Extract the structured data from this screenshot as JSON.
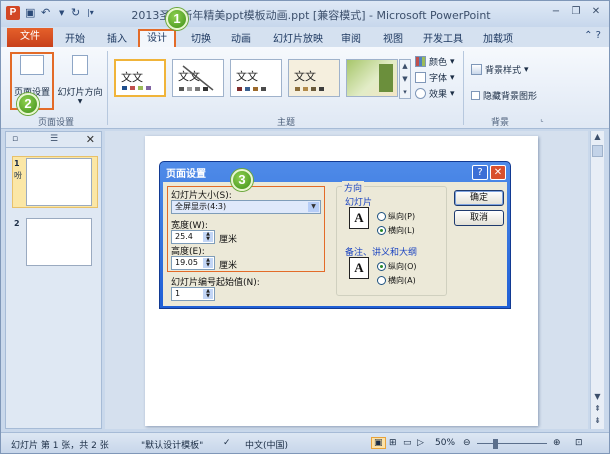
{
  "title_bar": {
    "title": "2013圣诞新年精美ppt模板动画.ppt [兼容模式] - Microsoft PowerPoint",
    "app_icon": "P",
    "quick_access": [
      "save-icon",
      "undo-icon",
      "redo-icon"
    ],
    "window_buttons": [
      "minimize-icon",
      "restore-icon",
      "close-icon"
    ]
  },
  "tabs": {
    "file": "文件",
    "items": [
      "开始",
      "插入",
      "设计",
      "切换",
      "动画",
      "幻灯片放映",
      "审阅",
      "视图",
      "开发工具",
      "加载项"
    ],
    "active": "设计"
  },
  "ribbon": {
    "page_setup_label": "页面设置",
    "orientation_label": "幻灯片方向",
    "group_page_setup": "页面设置",
    "group_themes": "主题",
    "group_background": "背景",
    "theme_sample_text": "文文",
    "colors_label": "颜色",
    "fonts_label": "字体",
    "effects_label": "效果",
    "background_styles_label": "背景样式",
    "hide_background_label": "隐藏背景图形"
  },
  "thumbnails": {
    "slides": [
      {
        "number": "1",
        "note": "吩"
      },
      {
        "number": "2",
        "note": ""
      }
    ]
  },
  "status_bar": {
    "slide_info": "幻灯片 第 1 张，共 2 张",
    "theme": "\"默认设计模板\"",
    "language": "中文(中国)",
    "zoom": "50%"
  },
  "dialog": {
    "title": "页面设置",
    "size_label": "幻灯片大小(S):",
    "size_value": "全屏显示(4:3)",
    "width_label": "宽度(W):",
    "width_value": "25.4",
    "height_label": "高度(E):",
    "height_value": "19.05",
    "unit": "厘米",
    "numbering_label": "幻灯片编号起始值(N):",
    "numbering_value": "1",
    "orientation_legend": "方向",
    "slides_legend": "幻灯片",
    "portrait_label": "纵向(P)",
    "landscape_label": "横向(L)",
    "notes_legend": "备注、讲义和大纲",
    "notes_portrait_label": "纵向(O)",
    "notes_landscape_label": "横向(A)",
    "ok_label": "确定",
    "cancel_label": "取消"
  },
  "callouts": [
    "1",
    "2",
    "3"
  ]
}
